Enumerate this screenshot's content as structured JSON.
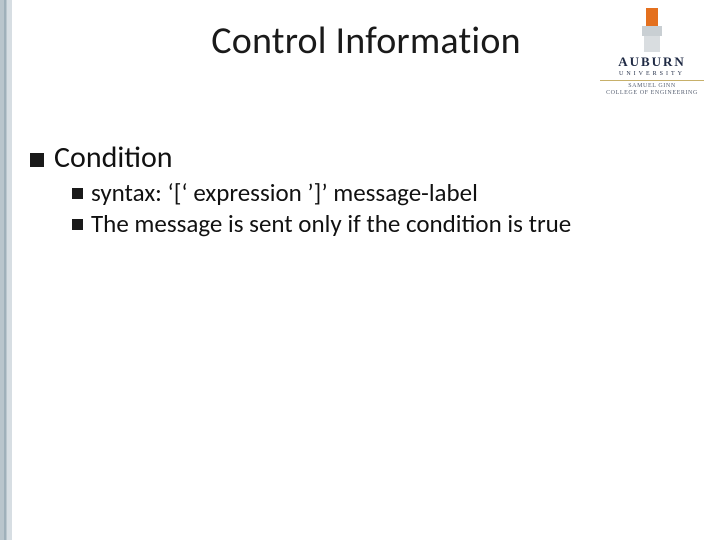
{
  "title": "Control Information",
  "logo": {
    "word": "AUBURN",
    "university": "UNIVERSITY",
    "college_line1": "SAMUEL GINN",
    "college_line2": "COLLEGE OF ENGINEERING"
  },
  "bullets": {
    "l1": "Condition",
    "l2": [
      "syntax: ‘[‘ expression ’]’ message-label",
      "The message is sent only if the condition is true"
    ]
  }
}
